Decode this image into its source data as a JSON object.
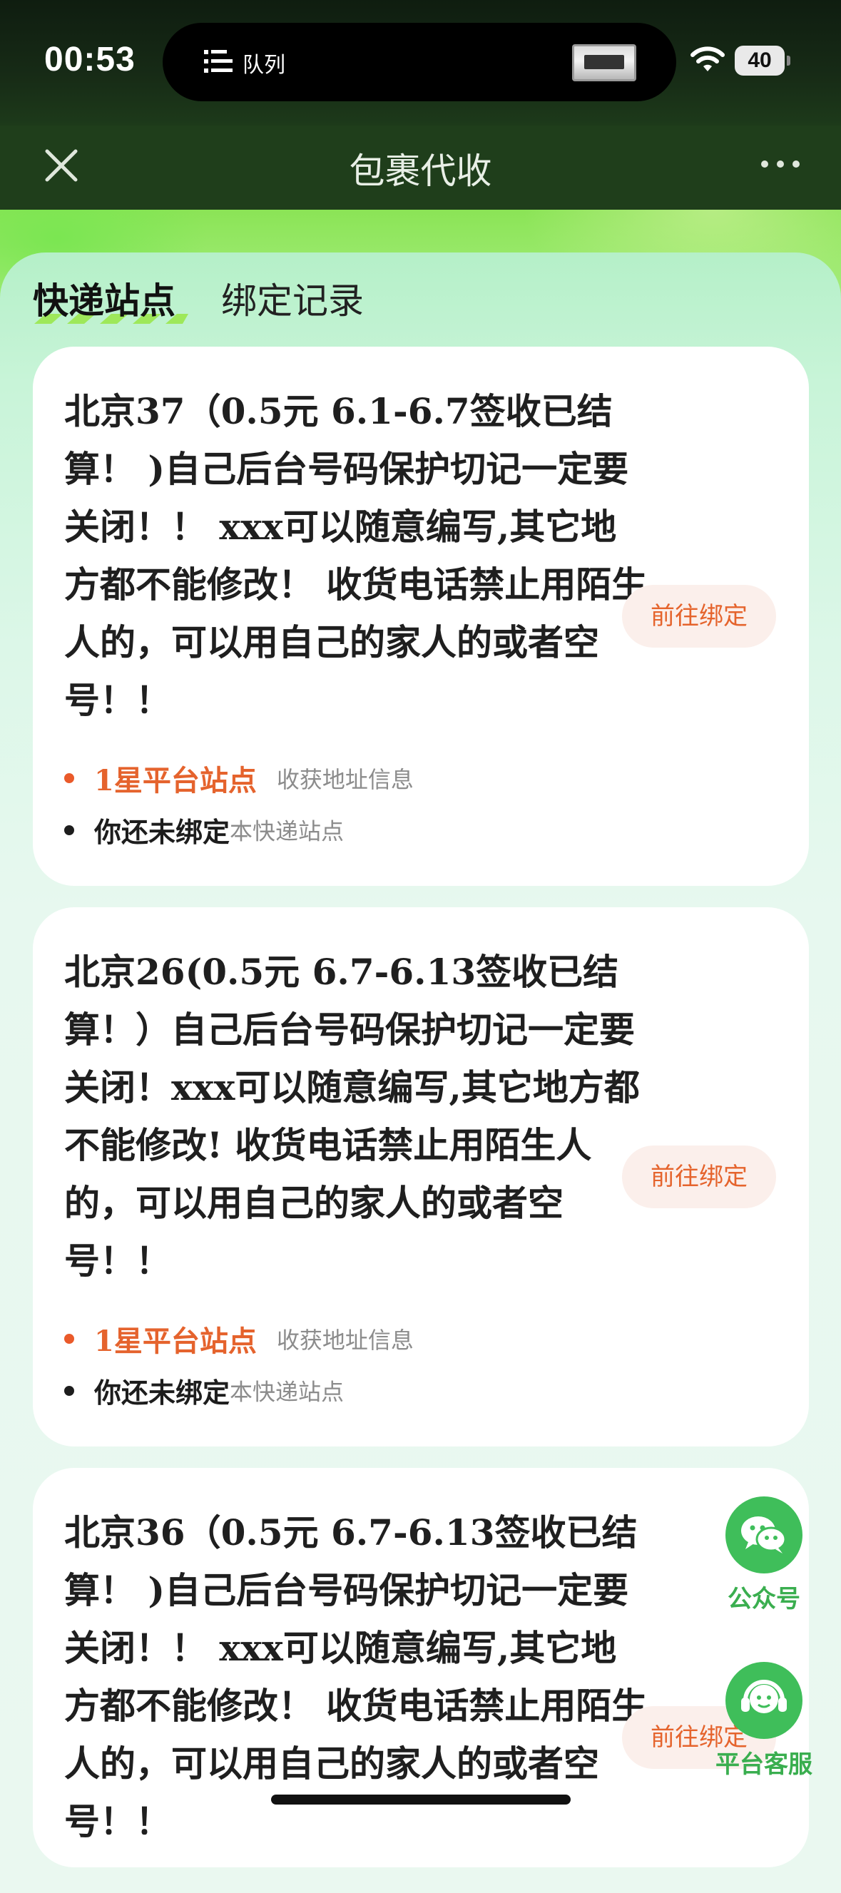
{
  "status_bar": {
    "time": "00:53",
    "island_label": "队列",
    "battery": "40"
  },
  "nav": {
    "title": "包裹代收"
  },
  "tabs": [
    {
      "label": "快递站点",
      "active": true
    },
    {
      "label": "绑定记录",
      "active": false
    }
  ],
  "cards": [
    {
      "title": "北京37（0.5元 6.1-6.7签收已结算！ )自己后台号码保护切记一定要关闭！！ xxx可以随意编写,其它地方都不能修改！ 收货电话禁止用陌生人的，可以用自己的家人的或者空号！！",
      "button": "前往绑定",
      "level": "1星平台站点",
      "meta": "收获地址信息",
      "unbound_strong": "你还未绑定",
      "unbound_rest": "本快递站点"
    },
    {
      "title": "北京26(0.5元 6.7-6.13签收已结算！）自己后台号码保护切记一定要关闭！xxx可以随意编写,其它地方都不能修改! 收货电话禁止用陌生人的，可以用自己的家人的或者空号！！",
      "button": "前往绑定",
      "level": "1星平台站点",
      "meta": "收获地址信息",
      "unbound_strong": "你还未绑定",
      "unbound_rest": "本快递站点"
    },
    {
      "title": "北京36（0.5元 6.7-6.13签收已结算！ )自己后台号码保护切记一定要关闭！！ xxx可以随意编写,其它地方都不能修改！ 收货电话禁止用陌生人的，可以用自己的家人的或者空号！！",
      "button": "前往绑定"
    }
  ],
  "floating": {
    "wechat_label": "公众号",
    "service_label": "平台客服"
  },
  "colors": {
    "accent_orange": "#e5642d",
    "brand_green": "#3fbe5a",
    "nav_dark": "#1f3e1b"
  },
  "icons": {
    "close": "close-icon",
    "more": "more-icon",
    "wechat": "wechat-icon",
    "service": "headset-icon",
    "wifi": "wifi-icon",
    "queue": "queue-icon"
  }
}
